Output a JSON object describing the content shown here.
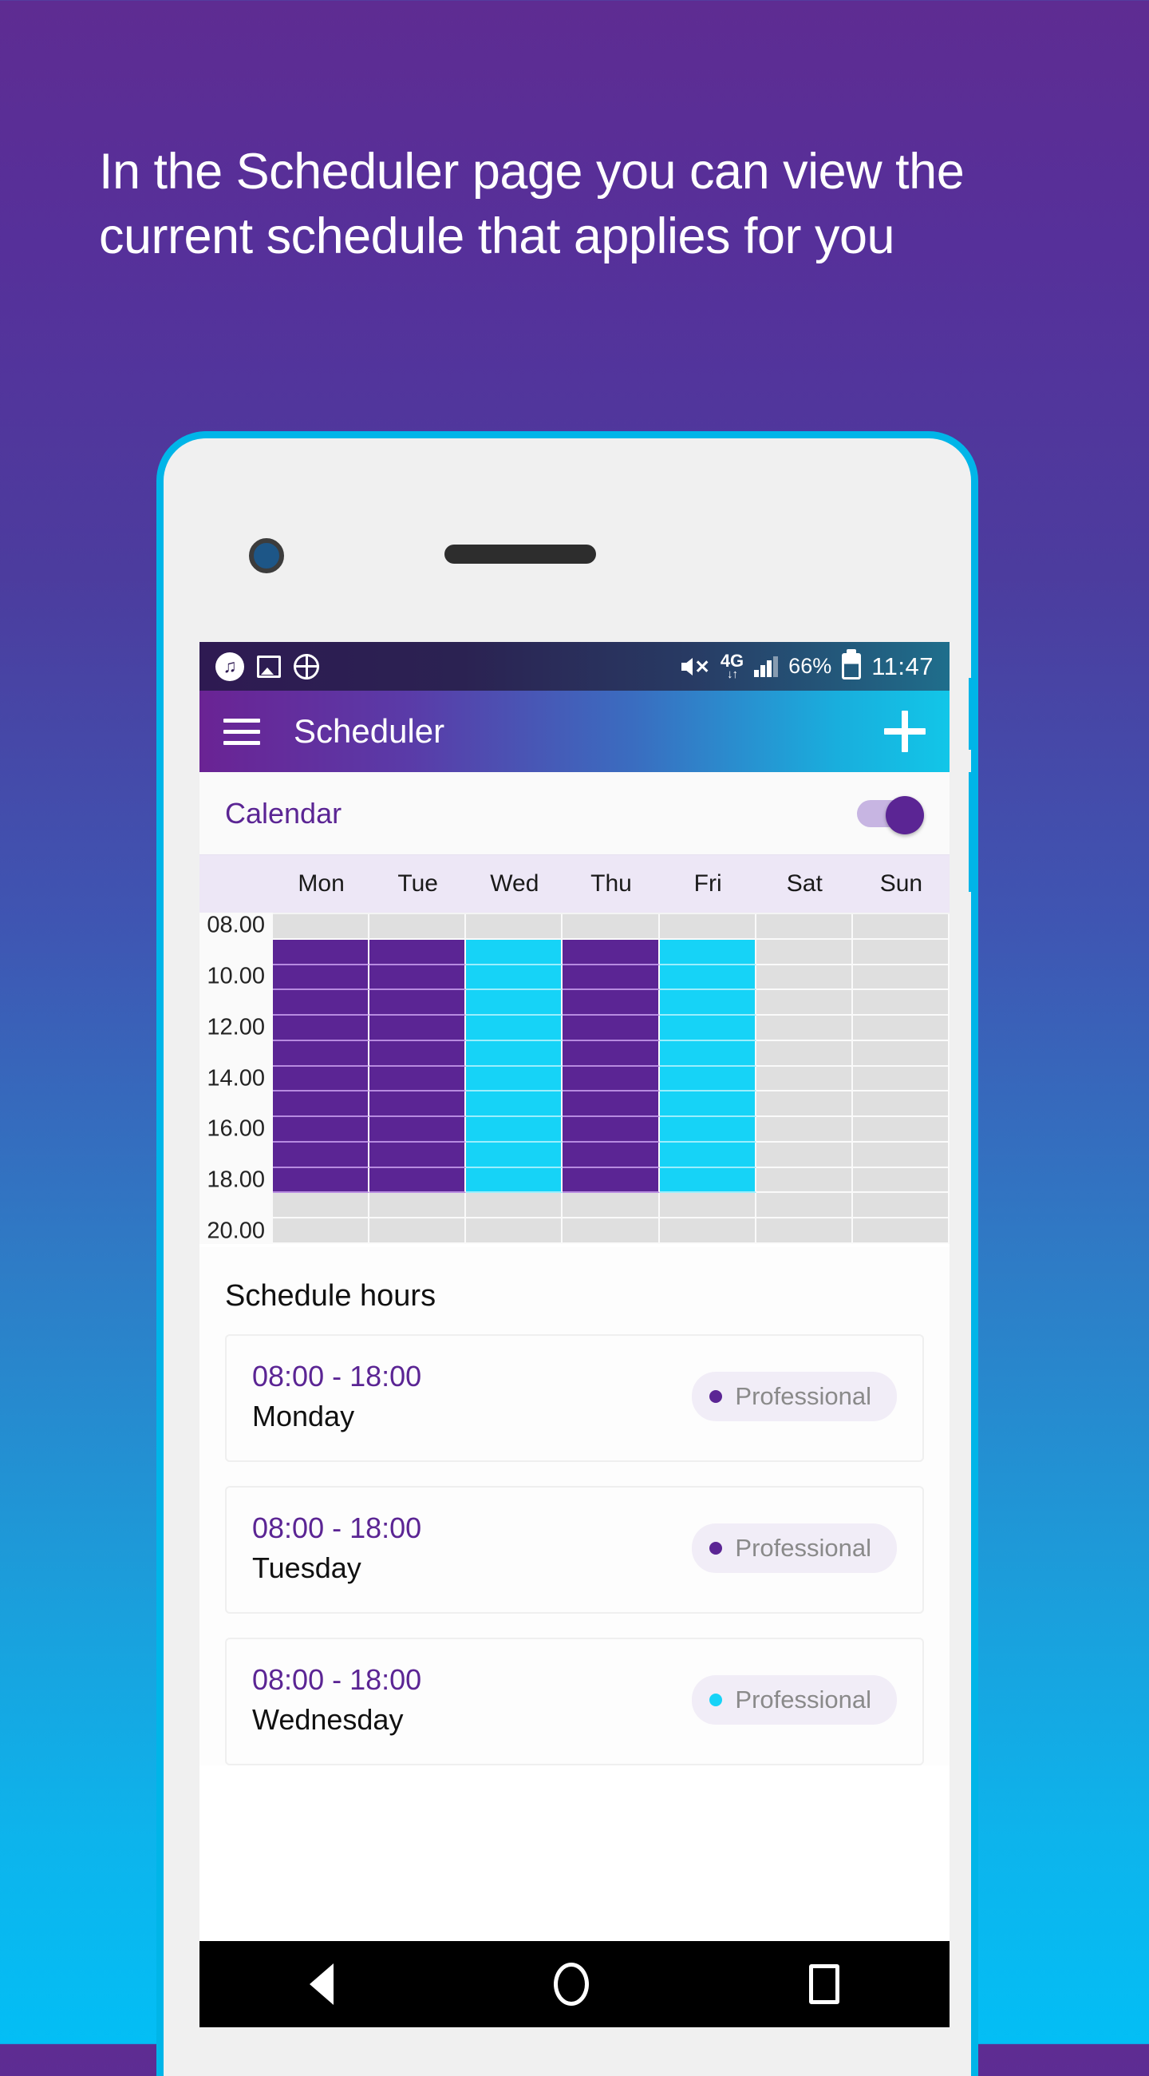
{
  "promo": {
    "headline": "In the Scheduler page you can view the current schedule that applies for you"
  },
  "colors": {
    "bg_top": "#5E2C92",
    "bg_bottom": "#03BEF5",
    "accent_purple": "#5B2594",
    "accent_cyan": "#16D3F7",
    "phone_frame": "#00B5E8"
  },
  "status_bar": {
    "icons_left": [
      "music-note-icon",
      "image-icon",
      "globe-download-icon"
    ],
    "mute_icon": "volume-mute-icon",
    "network": "4G",
    "network_arrows": "↓↑",
    "signal_icon": "signal-bars-icon",
    "battery_percent": "66%",
    "battery_icon": "battery-icon",
    "time": "11:47"
  },
  "app_bar": {
    "menu_icon": "hamburger-menu-icon",
    "title": "Scheduler",
    "add_icon": "plus-icon"
  },
  "calendar_toggle": {
    "label": "Calendar",
    "enabled": true
  },
  "calendar": {
    "days": [
      "Mon",
      "Tue",
      "Wed",
      "Thu",
      "Fri",
      "Sat",
      "Sun"
    ],
    "time_labels": [
      "08.00",
      "10.00",
      "12.00",
      "14.00",
      "16.00",
      "18.00",
      "20.00"
    ],
    "rows": 13,
    "day_colors": [
      "purple",
      "purple",
      "cyan",
      "purple",
      "cyan",
      "none",
      "none"
    ],
    "busy_start_row": 1,
    "busy_end_row": 10
  },
  "schedule": {
    "section_title": "Schedule hours",
    "items": [
      {
        "time": "08:00 - 18:00",
        "day": "Monday",
        "tag": "Professional",
        "tag_color": "#5B2594"
      },
      {
        "time": "08:00 - 18:00",
        "day": "Tuesday",
        "tag": "Professional",
        "tag_color": "#5B2594"
      },
      {
        "time": "08:00 - 18:00",
        "day": "Wednesday",
        "tag": "Professional",
        "tag_color": "#16D3F7"
      }
    ]
  },
  "nav_bar": {
    "back_icon": "back-triangle-icon",
    "home_icon": "home-circle-icon",
    "recents_icon": "recents-square-icon"
  }
}
